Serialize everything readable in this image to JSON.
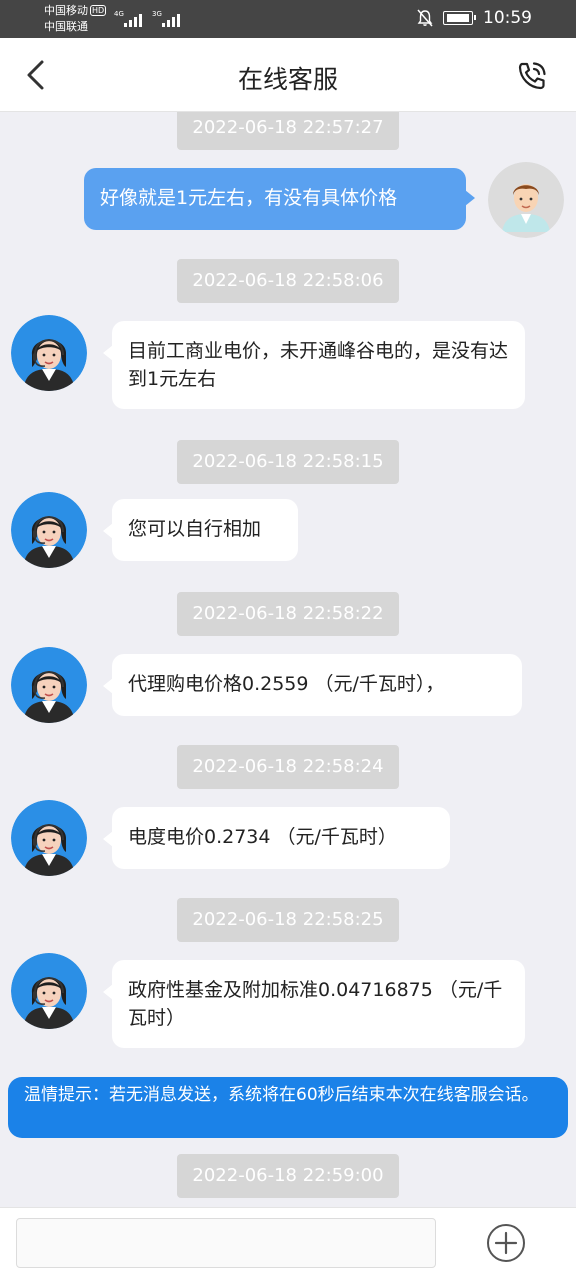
{
  "status_bar": {
    "carrier_1": "中国移动",
    "hd_badge": "HD",
    "carrier_2": "中国联通",
    "network_1": "4G",
    "network_2": "3G",
    "time": "10:59"
  },
  "header": {
    "title": "在线客服",
    "back_icon": "chevron-left-icon",
    "call_icon": "phone-call-icon"
  },
  "messages": [
    {
      "timestamp": "2022-06-18 22:57:27",
      "sender": "user",
      "text": "好像就是1元左右，有没有具体价格"
    },
    {
      "timestamp": "2022-06-18 22:58:06",
      "sender": "agent",
      "text": "目前工商业电价，未开通峰谷电的，是没有达到1元左右"
    },
    {
      "timestamp": "2022-06-18 22:58:15",
      "sender": "agent",
      "text": "您可以自行相加"
    },
    {
      "timestamp": "2022-06-18 22:58:22",
      "sender": "agent",
      "text": "代理购电价格0.2559 （元/千瓦时），"
    },
    {
      "timestamp": "2022-06-18 22:58:24",
      "sender": "agent",
      "text": "电度电价0.2734 （元/千瓦时）"
    },
    {
      "timestamp": "2022-06-18 22:58:25",
      "sender": "agent",
      "text": "政府性基金及附加标准0.04716875 （元/千瓦时）"
    }
  ],
  "notice": "温情提示：若无消息发送，系统将在60秒后结束本次在线客服会话。",
  "last_timestamp": "2022-06-18 22:59:00",
  "input": {
    "value": "",
    "placeholder": "",
    "add_icon": "plus-circle-icon"
  },
  "colors": {
    "user_bubble": "#5aa1f0",
    "notice_background": "#1b82e8",
    "timestamp_background": "#d6d6d6",
    "chat_background": "#efeff4"
  }
}
